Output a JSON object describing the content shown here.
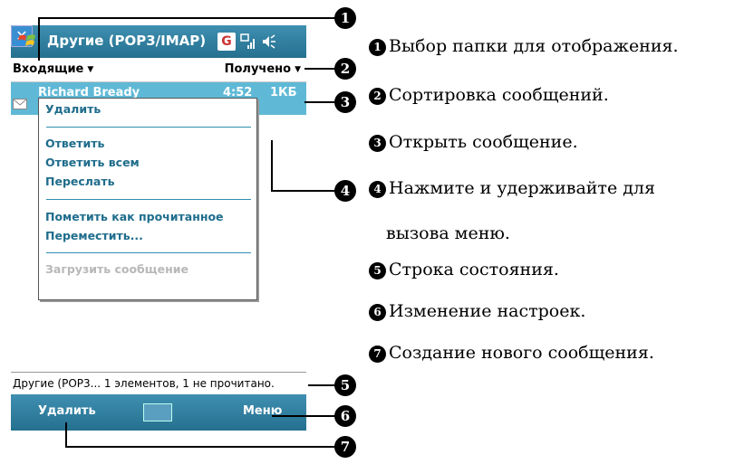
{
  "titlebar": {
    "title": "Другие (POP3/IMAP)",
    "g_label": "G"
  },
  "toolbar": {
    "folder": "Входящие",
    "sort": "Получено"
  },
  "message": {
    "sender": "Richard Bready",
    "time": "4:52",
    "size": "1КБ"
  },
  "context_menu": {
    "items": [
      "Удалить",
      "Ответить",
      "Ответить всем",
      "Переслать",
      "Пометить как прочитанное",
      "Переместить...",
      "Загрузить сообщение"
    ]
  },
  "status": "Другие (POP3...  1 элементов, 1 не прочитано.",
  "softkeys": {
    "left": "Удалить",
    "right": "Меню"
  },
  "callouts": [
    "1",
    "2",
    "3",
    "4",
    "5",
    "6",
    "7"
  ],
  "legend": [
    "Выбор папки для отображения.",
    "Сортировка сообщений.",
    "Открыть сообщение.",
    "Нажмите и удерживайте для",
    "вызова меню.",
    "Строка состояния.",
    "Изменение настроек.",
    "Создание нового сообщения."
  ],
  "colors": {
    "bar": "#2a7a9c",
    "highlight": "#5fb9d6",
    "menu_text": "#1f6d8c"
  }
}
